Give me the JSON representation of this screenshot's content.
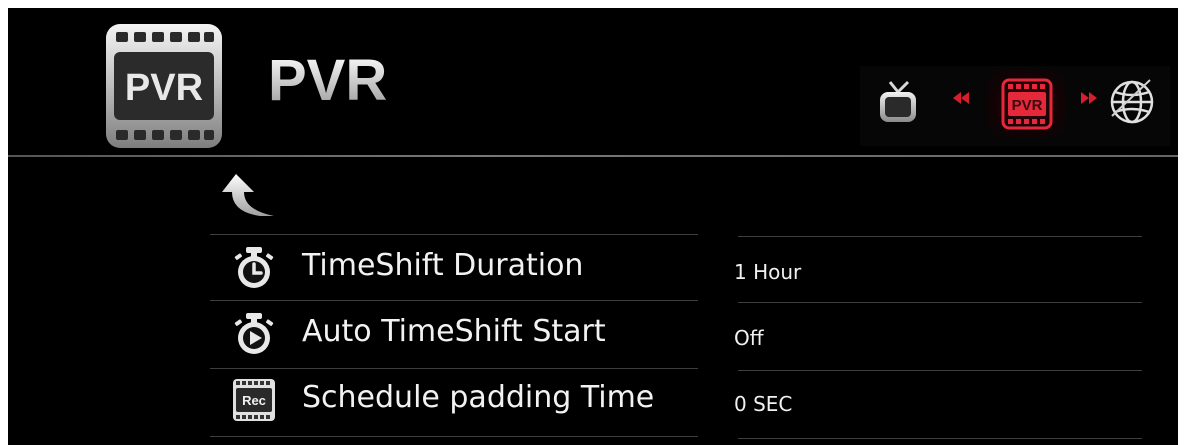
{
  "header": {
    "title": "PVR",
    "app_icon": "pvr-film-icon",
    "app_icon_text": "PVR"
  },
  "nav": {
    "items": [
      {
        "name": "tv-icon",
        "active": false
      },
      {
        "name": "prev-icon"
      },
      {
        "name": "pvr-icon",
        "active": true,
        "text": "PVR"
      },
      {
        "name": "next-icon"
      },
      {
        "name": "globe-icon",
        "active": false
      }
    ],
    "active_color": "#e5283a"
  },
  "menu": {
    "back_icon": "back-arrow-icon",
    "rows": [
      {
        "icon": "stopwatch-clock-icon",
        "label": "TimeShift Duration",
        "value": "1 Hour"
      },
      {
        "icon": "stopwatch-play-icon",
        "label": "Auto TimeShift Start",
        "value": "Off"
      },
      {
        "icon": "rec-film-icon",
        "icon_text": "Rec",
        "label": "Schedule padding Time",
        "value": "0 SEC"
      }
    ]
  }
}
